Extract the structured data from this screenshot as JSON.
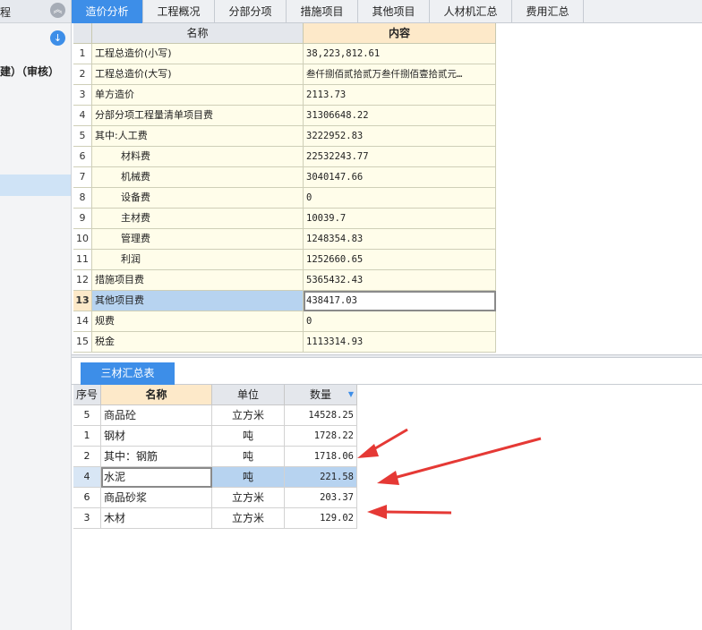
{
  "left_panel": {
    "title": "程",
    "project_label": "建）（审核）"
  },
  "tabs": [
    "造价分析",
    "工程概况",
    "分部分项",
    "措施项目",
    "其他项目",
    "人材机汇总",
    "费用汇总"
  ],
  "summary_table": {
    "columns": [
      "名称",
      "内容"
    ],
    "rows": [
      {
        "num": "1",
        "name": "工程总造价(小写)",
        "value": "38,223,812.61"
      },
      {
        "num": "2",
        "name": "工程总造价(大写)",
        "value": "叁仟捌佰贰拾贰万叁仟捌佰壹拾贰元…"
      },
      {
        "num": "3",
        "name": "单方造价",
        "value": "2113.73"
      },
      {
        "num": "4",
        "name": "分部分项工程量清单项目费",
        "value": "31306648.22"
      },
      {
        "num": "5",
        "name": "其中:人工费",
        "value": "3222952.83"
      },
      {
        "num": "6",
        "name": "材料费",
        "value": "22532243.77"
      },
      {
        "num": "7",
        "name": "机械费",
        "value": "3040147.66"
      },
      {
        "num": "8",
        "name": "设备费",
        "value": "0"
      },
      {
        "num": "9",
        "name": "主材费",
        "value": "10039.7"
      },
      {
        "num": "10",
        "name": "管理费",
        "value": "1248354.83"
      },
      {
        "num": "11",
        "name": "利润",
        "value": "1252660.65"
      },
      {
        "num": "12",
        "name": "措施项目费",
        "value": "5365432.43"
      },
      {
        "num": "13",
        "name": "其他项目费",
        "value": "438417.03"
      },
      {
        "num": "14",
        "name": "规费",
        "value": "0"
      },
      {
        "num": "15",
        "name": "税金",
        "value": "1113314.93"
      }
    ]
  },
  "lower_tab": "三材汇总表",
  "materials_table": {
    "columns": [
      "序号",
      "名称",
      "单位",
      "数量"
    ],
    "rows": [
      {
        "num": "5",
        "name": "商品砼",
        "unit": "立方米",
        "qty": "14528.25"
      },
      {
        "num": "1",
        "name": "钢材",
        "unit": "吨",
        "qty": "1728.22"
      },
      {
        "num": "2",
        "name": "其中：钢筋",
        "unit": "吨",
        "qty": "1718.06"
      },
      {
        "num": "4",
        "name": "水泥",
        "unit": "吨",
        "qty": "221.58"
      },
      {
        "num": "6",
        "name": "商品砂浆",
        "unit": "立方米",
        "qty": "203.37"
      },
      {
        "num": "3",
        "name": "木材",
        "unit": "立方米",
        "qty": "129.02"
      }
    ]
  },
  "colors": {
    "accent": "#3d8ee8",
    "annotation_arrow": "#e53935",
    "cell_bg": "#fffdea",
    "selection": "#b7d3f0"
  }
}
